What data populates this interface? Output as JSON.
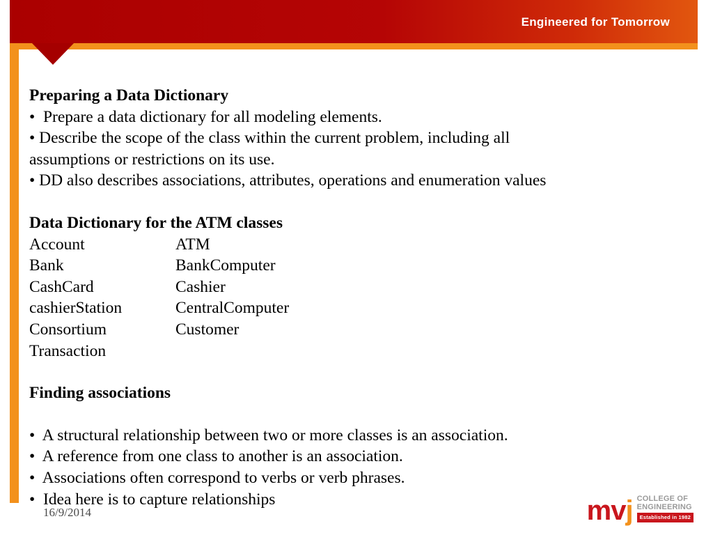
{
  "banner": {
    "tagline": "Engineered for Tomorrow"
  },
  "slide": {
    "heading1": "Preparing a Data Dictionary",
    "bullets1": [
      "•  Prepare a data dictionary for all modeling elements.",
      "• Describe the scope of the class within the current problem, including all",
      "assumptions or restrictions on its use.",
      "• DD also describes associations, attributes, operations and enumeration values"
    ],
    "heading2": "Data Dictionary for the ATM classes",
    "class_table": [
      {
        "left": "Account",
        "right": "ATM"
      },
      {
        "left": "Bank",
        "right": "BankComputer"
      },
      {
        "left": "CashCard",
        "right": "Cashier"
      },
      {
        "left": "cashierStation",
        "right": "CentralComputer"
      },
      {
        "left": "Consortium",
        "right": "Customer"
      },
      {
        "left": "Transaction",
        "right": ""
      }
    ],
    "heading3": "Finding associations",
    "bullets2": [
      "•  A structural relationship between two or more classes is an association.",
      "•  A reference from one class to another is an association.",
      "•  Associations often correspond to verbs or verb phrases.",
      "•  Idea here is to capture relationships"
    ]
  },
  "footer": {
    "date": "16/9/2014"
  },
  "logo": {
    "mark_m": "m",
    "mark_v": "v",
    "mark_j": "j",
    "line1": "COLLEGE OF",
    "line2": "ENGINEERING",
    "established": "Established in 1982"
  }
}
